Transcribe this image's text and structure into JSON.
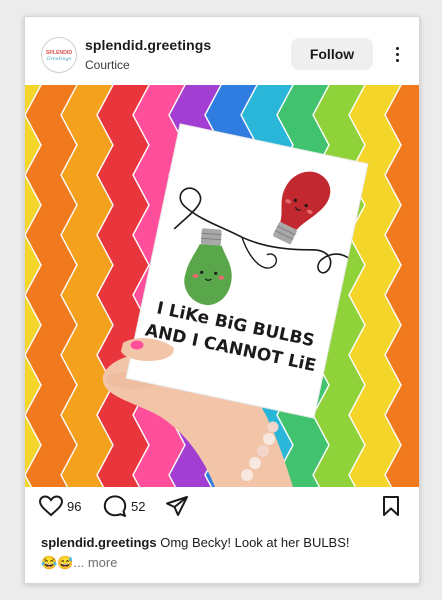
{
  "post": {
    "account_name": "splendid.greetings",
    "location": "Courtice",
    "follow_label": "Follow",
    "avatar_text": "SPLENDID Greetings",
    "avatar_icon": "brand-logo-icon"
  },
  "card_art": {
    "line1": "I LiKe BiG BULBS",
    "line2": "AND I CANNOT LiE"
  },
  "actions": {
    "like_icon": "heart-icon",
    "like_count": "96",
    "comment_icon": "comment-icon",
    "comment_count": "52",
    "share_icon": "send-icon",
    "save_icon": "bookmark-icon"
  },
  "caption": {
    "user": "splendid.greetings",
    "text": "Omg Becky! Look at her BULBS!",
    "emoji": "😂😅",
    "more": "... more"
  },
  "colors": {
    "stripes": [
      "#f07a1d",
      "#f4a21e",
      "#e8363c",
      "#ff4f9a",
      "#a23fd2",
      "#2f7de1",
      "#29b6d9",
      "#41c26e",
      "#8fd23a",
      "#f4d52a"
    ],
    "text": "#1b1b1b",
    "follow_bg": "#efefef"
  }
}
